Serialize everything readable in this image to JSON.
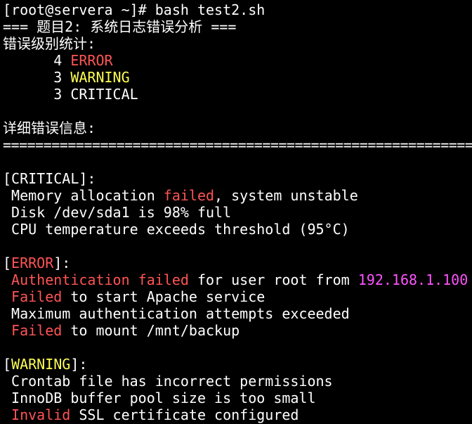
{
  "colors": {
    "background": "#000000",
    "foreground": "#ffffff",
    "error": "#ff5454",
    "warning": "#ffff54",
    "ip": "#ff54ff"
  },
  "terminal": {
    "prompt_line": "[root@servera ~]# bash test2.sh",
    "title_line": "=== 题目2: 系统日志错误分析 ===",
    "stats_heading": "错误级别统计:",
    "stats": [
      {
        "count": "      4 ",
        "level": "ERROR"
      },
      {
        "count": "      3 ",
        "level": "WARNING"
      },
      {
        "count": "      3 ",
        "level": "CRITICAL"
      }
    ],
    "details_heading": "详细错误信息:",
    "separator": "==============================================================",
    "critical": {
      "header_open": "[",
      "header_level": "CRITICAL",
      "header_close": "]:",
      "lines": [
        {
          "pre": " Memory allocation ",
          "hl": "failed",
          "post": ", system unstable"
        },
        {
          "text": " Disk /dev/sda1 is 98% full"
        },
        {
          "text": " CPU temperature exceeds threshold (95°C)"
        }
      ]
    },
    "error": {
      "header_open": "[",
      "header_level": "ERROR",
      "header_close": "]:",
      "lines": [
        {
          "hl": " Authentication failed",
          "mid": " for user root from ",
          "ip": "192.168.1.100"
        },
        {
          "hl": " Failed",
          "post": " to start Apache service"
        },
        {
          "text": " Maximum authentication attempts exceeded"
        },
        {
          "hl": " Failed",
          "post": " to mount /mnt/backup"
        }
      ]
    },
    "warning": {
      "header_open": "[",
      "header_level": "WARNING",
      "header_close": "]:",
      "lines": [
        {
          "text": " Crontab file has incorrect permissions"
        },
        {
          "text": " InnoDB buffer pool size is too small"
        },
        {
          "hl": " Invalid",
          "post": " SSL certificate configured"
        }
      ]
    }
  }
}
